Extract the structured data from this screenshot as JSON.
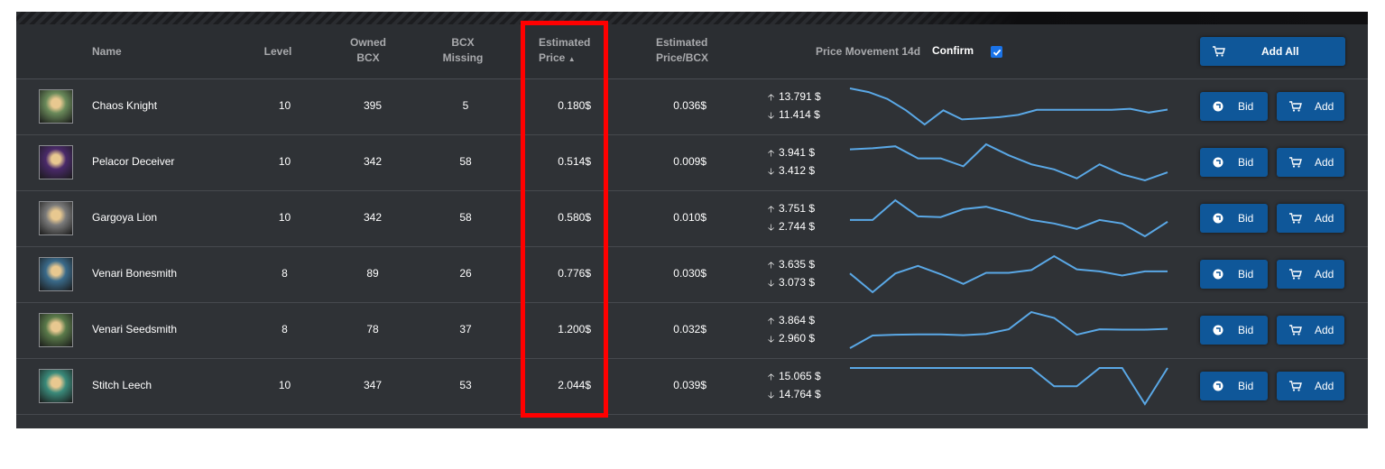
{
  "header": {
    "name": "Name",
    "level": "Level",
    "owned": [
      "Owned",
      "BCX"
    ],
    "missing": [
      "BCX",
      "Missing"
    ],
    "est_price": [
      "Estimated",
      "Price"
    ],
    "est_price_sort": "▲",
    "est_price_bcx": [
      "Estimated",
      "Price/BCX"
    ],
    "price_movement": "Price Movement 14d",
    "confirm": "Confirm",
    "confirm_checked": true,
    "add_all": "Add All"
  },
  "buttons": {
    "bid": "Bid",
    "add": "Add"
  },
  "rows": [
    {
      "name": "Chaos Knight",
      "level": "10",
      "owned": "395",
      "missing": "5",
      "price": "0.180$",
      "price_bcx": "0.036$",
      "up": "13.791 $",
      "down": "11.414 $",
      "avatar_color": "#6a8a5a",
      "spark": [
        13.791,
        13.55,
        13.1,
        12.35,
        11.42,
        12.35,
        11.75,
        11.82,
        11.9,
        12.05,
        12.38,
        12.38,
        12.38,
        12.38,
        12.38,
        12.45,
        12.2,
        12.4
      ]
    },
    {
      "name": "Pelacor Deceiver",
      "level": "10",
      "owned": "342",
      "missing": "58",
      "price": "0.514$",
      "price_bcx": "0.009$",
      "up": "3.941 $",
      "down": "3.412 $",
      "avatar_color": "#4a2a6a",
      "spark": [
        3.89,
        3.9,
        3.92,
        3.8,
        3.8,
        3.72,
        3.94,
        3.83,
        3.74,
        3.69,
        3.6,
        3.74,
        3.64,
        3.58,
        3.66
      ]
    },
    {
      "name": "Gargoya Lion",
      "level": "10",
      "owned": "342",
      "missing": "58",
      "price": "0.580$",
      "price_bcx": "0.010$",
      "up": "3.751 $",
      "down": "2.744 $",
      "avatar_color": "#7a7a7a",
      "spark": [
        3.2,
        3.2,
        3.75,
        3.3,
        3.28,
        3.5,
        3.57,
        3.4,
        3.2,
        3.1,
        2.95,
        3.2,
        3.1,
        2.744,
        3.15
      ]
    },
    {
      "name": "Venari Bonesmith",
      "level": "8",
      "owned": "89",
      "missing": "26",
      "price": "0.776$",
      "price_bcx": "0.030$",
      "up": "3.635 $",
      "down": "3.073 $",
      "avatar_color": "#3a6a8a",
      "spark": [
        3.35,
        3.08,
        3.35,
        3.46,
        3.34,
        3.2,
        3.36,
        3.36,
        3.4,
        3.6,
        3.41,
        3.38,
        3.32,
        3.38,
        3.38
      ]
    },
    {
      "name": "Venari Seedsmith",
      "level": "8",
      "owned": "78",
      "missing": "37",
      "price": "1.200$",
      "price_bcx": "0.032$",
      "up": "3.864 $",
      "down": "2.960 $",
      "avatar_color": "#5a7a4a",
      "spark": [
        3.0,
        3.3,
        3.32,
        3.33,
        3.33,
        3.31,
        3.34,
        3.45,
        3.86,
        3.72,
        3.32,
        3.45,
        3.44,
        3.44,
        3.46
      ]
    },
    {
      "name": "Stitch Leech",
      "level": "10",
      "owned": "347",
      "missing": "53",
      "price": "2.044$",
      "price_bcx": "0.039$",
      "up": "15.065 $",
      "down": "14.764 $",
      "avatar_color": "#3a8a7a",
      "spark": [
        15.06,
        15.06,
        15.06,
        15.06,
        15.06,
        15.06,
        15.06,
        15.06,
        15.06,
        14.91,
        14.91,
        15.06,
        15.06,
        14.764,
        15.06
      ]
    }
  ],
  "colors": {
    "accent": "#0f5799",
    "highlight": "#ff0000",
    "spark": "#5aa8e6"
  }
}
